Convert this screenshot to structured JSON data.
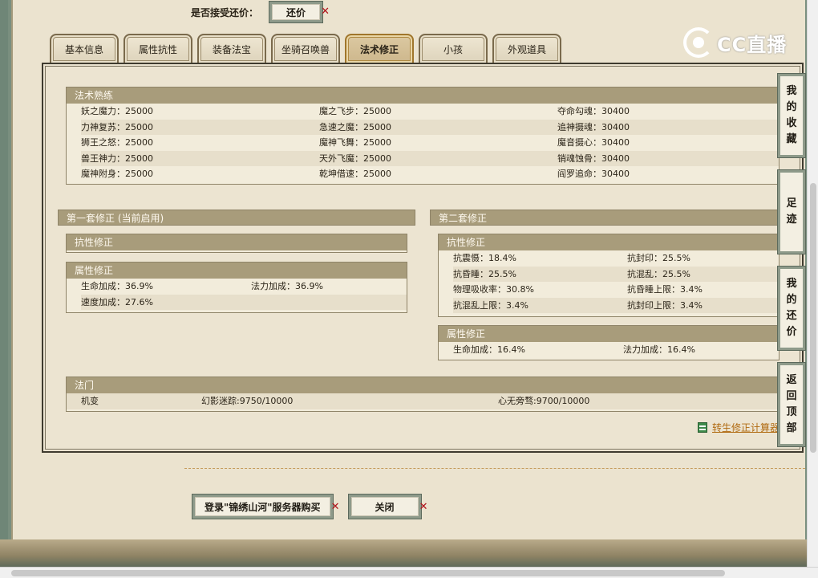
{
  "accept": {
    "label": "是否接受还价：",
    "button": "还价"
  },
  "logo": {
    "text": "CC直播"
  },
  "tabs": [
    {
      "label": "基本信息",
      "active": false
    },
    {
      "label": "属性抗性",
      "active": false
    },
    {
      "label": "装备法宝",
      "active": false
    },
    {
      "label": "坐骑召唤兽",
      "active": false
    },
    {
      "label": "法术修正",
      "active": true
    },
    {
      "label": "小孩",
      "active": false
    },
    {
      "label": "外观道具",
      "active": false
    }
  ],
  "spell_mastery": {
    "title": "法术熟练",
    "rows": [
      [
        "妖之魔力：25000",
        "魔之飞步：25000",
        "夺命勾魂：30400"
      ],
      [
        "力神复苏：25000",
        "急速之魔：25000",
        "追神摄魂：30400"
      ],
      [
        "狮王之怒：25000",
        "魔神飞舞：25000",
        "魔音摄心：30400"
      ],
      [
        "兽王神力：25000",
        "天外飞魔：25000",
        "销魂蚀骨：30400"
      ],
      [
        "魔神附身：25000",
        "乾坤借速：25000",
        "阎罗追命：30400"
      ]
    ]
  },
  "set1": {
    "title": "第一套修正 (当前启用)",
    "resist_title": "抗性修正",
    "attr_title": "属性修正",
    "attr_rows": [
      [
        "生命加成：36.9%",
        "法力加成：36.9%"
      ],
      [
        "速度加成：27.6%",
        ""
      ]
    ]
  },
  "set2": {
    "title": "第二套修正",
    "resist_title": "抗性修正",
    "resist_rows": [
      [
        "抗震慑：18.4%",
        "抗封印：25.5%"
      ],
      [
        "抗昏睡：25.5%",
        "抗混乱：25.5%"
      ],
      [
        "物理吸收率：30.8%",
        "抗昏睡上限：3.4%"
      ],
      [
        "抗混乱上限：3.4%",
        "抗封印上限：3.4%"
      ]
    ],
    "attr_title": "属性修正",
    "attr_rows": [
      [
        "生命加成：16.4%",
        "法力加成：16.4%"
      ]
    ]
  },
  "fa_men": {
    "title": "法门",
    "row": [
      "机变",
      "幻影迷踪:9750/10000",
      "心无旁骛:9700/10000"
    ]
  },
  "side_nav": [
    {
      "label": "我的收藏",
      "chars": [
        "我",
        "的",
        "收",
        "藏"
      ]
    },
    {
      "label": "足迹",
      "chars": [
        "足",
        "迹"
      ]
    },
    {
      "label": "我的还价",
      "chars": [
        "我",
        "的",
        "还",
        "价"
      ]
    },
    {
      "label": "返回顶部",
      "chars": [
        "返",
        "回",
        "顶",
        "部"
      ]
    }
  ],
  "calc_link": "转生修正计算器",
  "bottom": {
    "login_button": "登录\"锦绣山河\"服务器购买",
    "close_button": "关闭"
  },
  "colors": {
    "header_bg": "#a89c7b",
    "active_tab": "#cdb78c",
    "link": "#b06a10",
    "close_x": "#b0121a"
  }
}
